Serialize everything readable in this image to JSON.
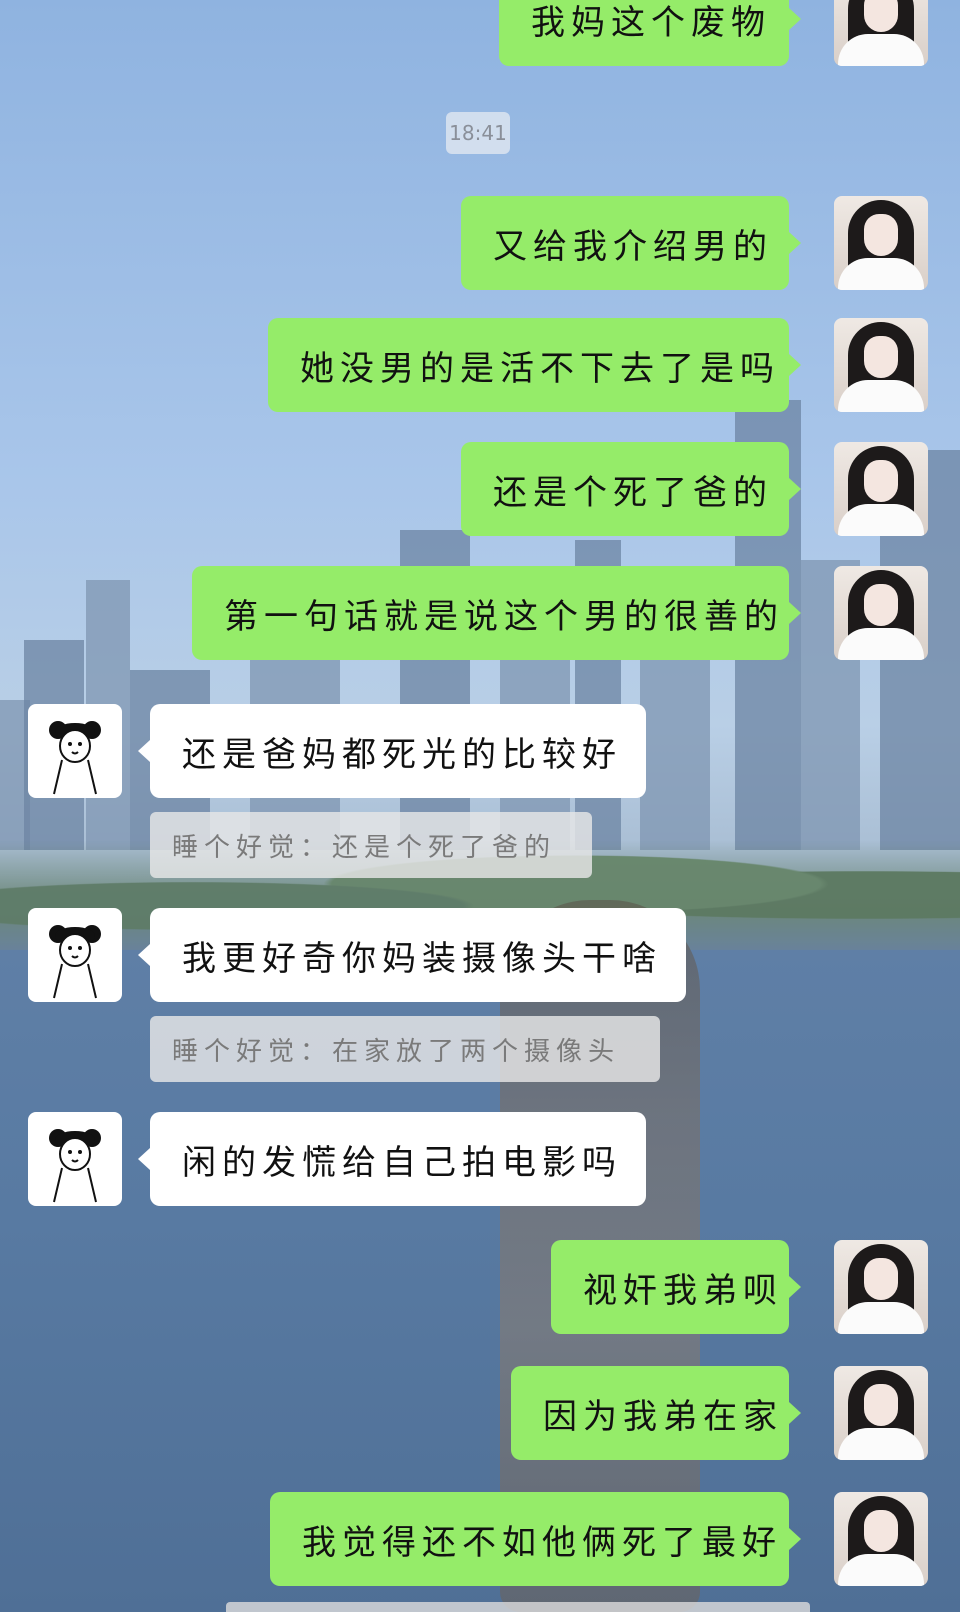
{
  "chat": {
    "timestamp": "18:41",
    "messages": [
      {
        "side": "out",
        "text": "我妈这个废物"
      },
      {
        "side": "out",
        "text": "又给我介绍男的"
      },
      {
        "side": "out",
        "text": "她没男的是活不下去了是吗"
      },
      {
        "side": "out",
        "text": "还是个死了爸的"
      },
      {
        "side": "out",
        "text": "第一句话就是说这个男的很善的"
      },
      {
        "side": "in",
        "text": "还是爸妈都死光的比较好",
        "quote": "睡个好觉：还是个死了爸的"
      },
      {
        "side": "in",
        "text": "我更好奇你妈装摄像头干啥",
        "quote": "睡个好觉：在家放了两个摄像头"
      },
      {
        "side": "in",
        "text": "闲的发慌给自己拍电影吗"
      },
      {
        "side": "out",
        "text": "视奸我弟呗"
      },
      {
        "side": "out",
        "text": "因为我弟在家"
      },
      {
        "side": "out",
        "text": "我觉得还不如他俩死了最好"
      }
    ]
  },
  "colors": {
    "outgoing_bubble": "#95ec69",
    "incoming_bubble": "#ffffff",
    "quote_bg": "#e6e6e6"
  },
  "icons": {
    "me_avatar": "girl-portrait-avatar",
    "other_avatar": "stick-figure-avatar"
  }
}
